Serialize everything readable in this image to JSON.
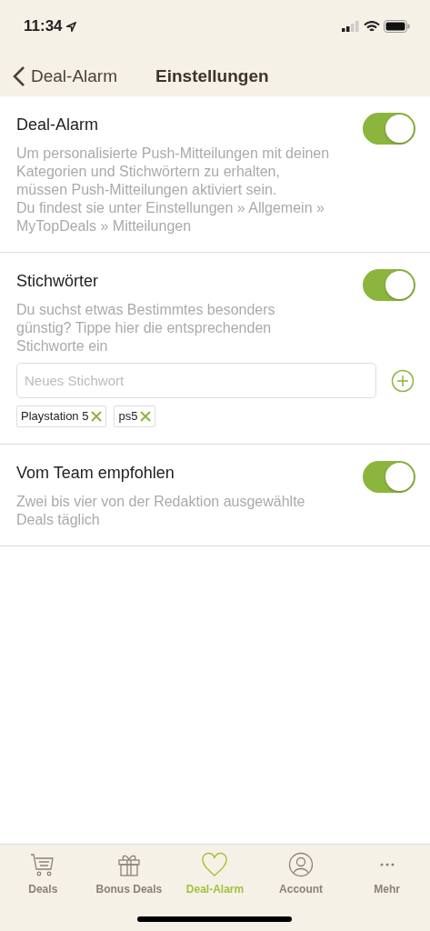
{
  "status_bar": {
    "time": "11:34"
  },
  "nav": {
    "back": "Deal-Alarm",
    "title": "Einstellungen"
  },
  "sections": [
    {
      "title": "Deal-Alarm",
      "on": true,
      "paragraphs": [
        "Um personalisierte Push-Mitteilungen mit deinen Kategorien und Stichwörtern zu erhalten, müssen Push-Mitteilungen aktiviert sein.",
        "Du findest sie unter Einstellungen » Allgemein » MyTopDeals » Mitteilungen"
      ]
    },
    {
      "title": "Stichwörter",
      "on": true,
      "paragraphs": [
        "Du suchst etwas Bestimmtes besonders günstig? Tippe hier die entsprechenden Stichworte ein"
      ],
      "input": {
        "placeholder": "Neues Stichwort"
      },
      "tags": [
        "Playstation 5",
        "ps5"
      ]
    },
    {
      "title": "Vom Team empfohlen",
      "on": true,
      "paragraphs": [
        "Zwei bis vier von der Redaktion ausgewählte Deals täglich"
      ]
    }
  ],
  "tab_bar": [
    {
      "label": "Deals",
      "selected": false
    },
    {
      "label": "Bonus Deals",
      "selected": false
    },
    {
      "label": "Deal-Alarm",
      "selected": true
    },
    {
      "label": "Account",
      "selected": false
    },
    {
      "label": "Mehr",
      "selected": false
    }
  ]
}
